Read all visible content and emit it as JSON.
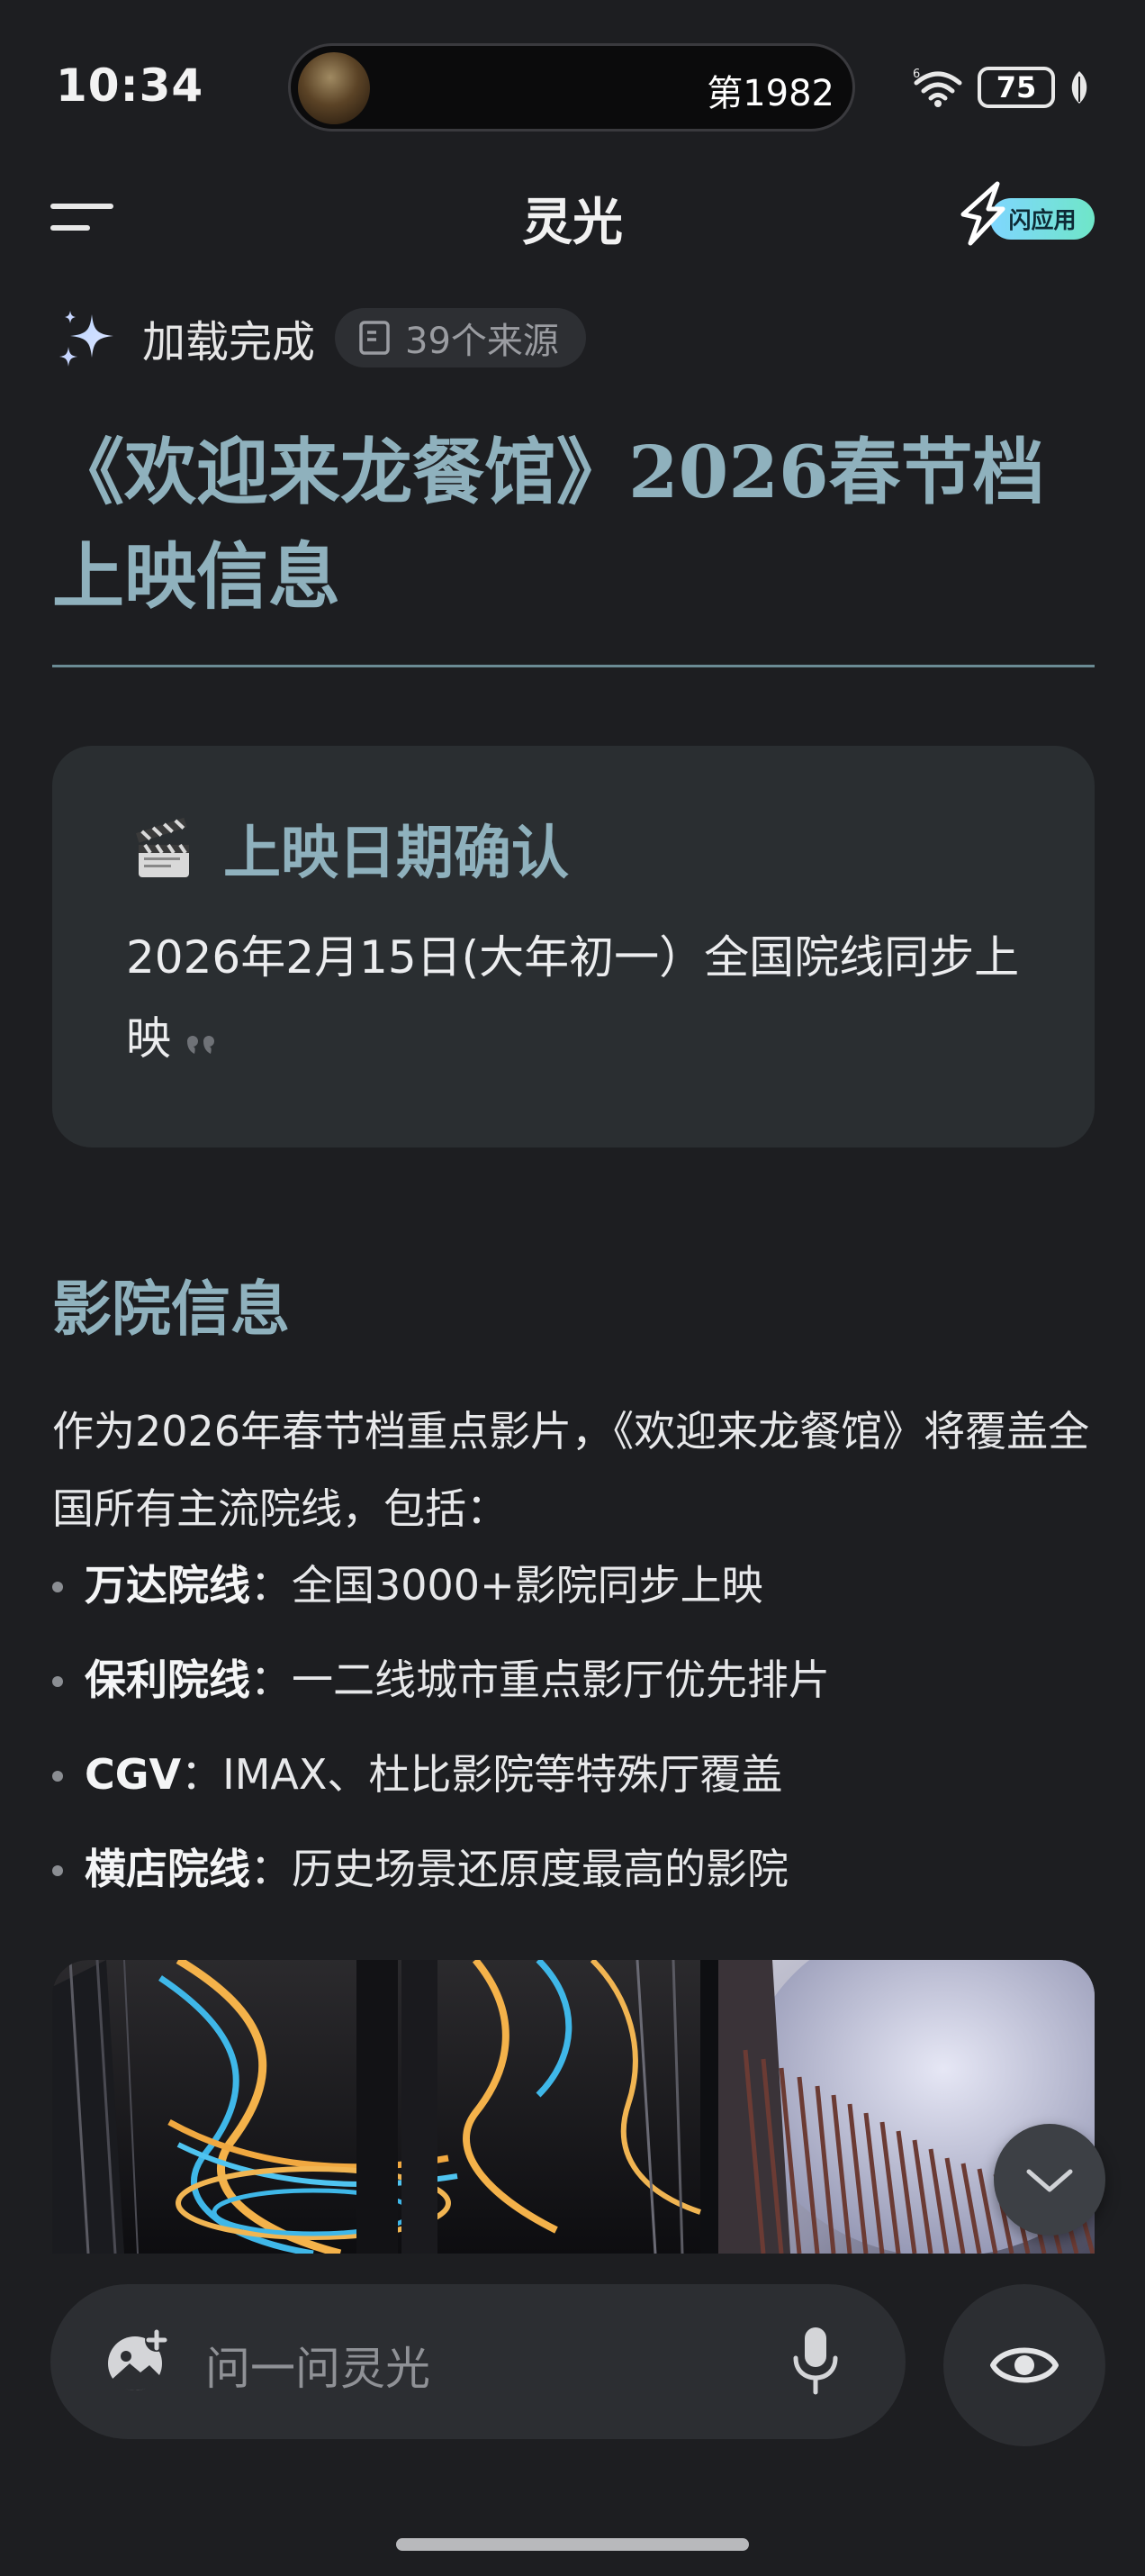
{
  "status_bar": {
    "time": "10:34",
    "island_text": "第1982",
    "battery": "75"
  },
  "header": {
    "title": "灵光",
    "flash_app_label": "闪应用"
  },
  "load_status": {
    "text": "加载完成",
    "sources": "39个来源"
  },
  "article": {
    "title_line1": "《欢迎来龙餐馆》2026春节档",
    "title_line2": "上映信息",
    "card": {
      "heading": "上映日期确认",
      "body": "2026年2月15日(大年初一）全国院线同步上映"
    },
    "section": {
      "heading": "影院信息",
      "intro": "作为2026年春节档重点影片，《欢迎来龙餐馆》将覆盖全国所有主流院线，包括：",
      "items": [
        {
          "label": "万达院线",
          "sep": "：",
          "text": "全国3000+影院同步上映"
        },
        {
          "label": "保利院线",
          "sep": "：",
          "text": "一二线城市重点影厅优先排片"
        },
        {
          "label": "CGV",
          "sep": "：",
          "text": "IMAX、杜比影院等特殊厅覆盖"
        },
        {
          "label": "横店院线",
          "sep": "：",
          "text": "历史场景还原度最高的影院"
        }
      ]
    }
  },
  "input": {
    "placeholder": "问一问灵光"
  },
  "colors": {
    "background": "#1d1e21",
    "accent_title": "#8fb1bd",
    "card_bg": "#2a2e31",
    "flash_gradient_start": "#7fd6ff",
    "flash_gradient_end": "#6fe6c8"
  },
  "icons": [
    "menu-icon",
    "flash-bolt-icon",
    "sparkle-icon",
    "document-icon",
    "clapper-icon",
    "quote-icon",
    "chevron-down-icon",
    "image-add-icon",
    "microphone-icon",
    "eye-icon",
    "wifi-icon",
    "leaf-icon"
  ]
}
